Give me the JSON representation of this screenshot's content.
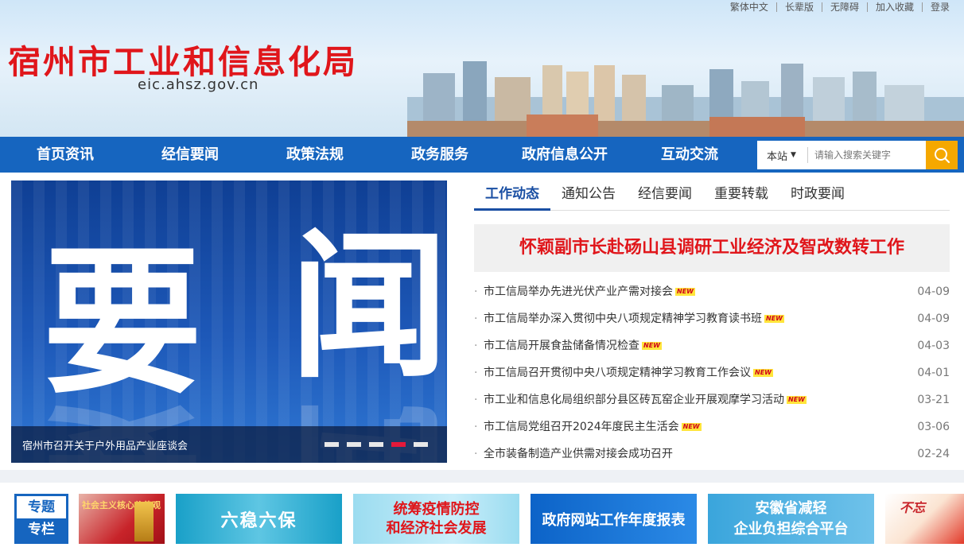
{
  "topbar": {
    "items": [
      "繁体中文",
      "长辈版",
      "无障碍",
      "加入收藏",
      "登录"
    ]
  },
  "header": {
    "title": "宿州市工业和信息化局",
    "domain": "eic.ahsz.gov.cn"
  },
  "nav": {
    "items": [
      "首页资讯",
      "经信要闻",
      "政策法规",
      "政务服务",
      "政府信息公开",
      "互动交流"
    ]
  },
  "search": {
    "scope": "本站",
    "placeholder": "请输入搜索关键字"
  },
  "carousel": {
    "big_text": [
      "要",
      "闻"
    ],
    "caption": "宿州市召开关于户外用品产业座谈会",
    "dot_count": 5,
    "active_dot": 4
  },
  "news": {
    "tabs": [
      "工作动态",
      "通知公告",
      "经信要闻",
      "重要转载",
      "时政要闻"
    ],
    "active_tab": 0,
    "headline": "怀颖副市长赴砀山县调研工业经济及智改数转工作",
    "new_badge": "NEW",
    "items": [
      {
        "title": "市工信局举办先进光伏产业产需对接会",
        "date": "04-09",
        "is_new": true
      },
      {
        "title": "市工信局举办深入贯彻中央八项规定精神学习教育读书班",
        "date": "04-09",
        "is_new": true
      },
      {
        "title": "市工信局开展食盐储备情况检查",
        "date": "04-03",
        "is_new": true
      },
      {
        "title": "市工信局召开贯彻中央八项规定精神学习教育工作会议",
        "date": "04-01",
        "is_new": true
      },
      {
        "title": "市工业和信息化局组织部分县区砖瓦窑企业开展观摩学习活动",
        "date": "03-21",
        "is_new": true
      },
      {
        "title": "市工信局党组召开2024年度民主生活会",
        "date": "03-06",
        "is_new": true
      },
      {
        "title": "全市装备制造产业供需对接会成功召开",
        "date": "02-24",
        "is_new": false
      }
    ]
  },
  "special": {
    "label_top": "专题",
    "label_bottom": "专栏",
    "banners": [
      {
        "line1": "社会主义核心价值观",
        "line2": ""
      },
      {
        "line1": "六稳六保",
        "line2": ""
      },
      {
        "line1": "统筹疫情防控",
        "line2": "和经济社会发展"
      },
      {
        "line1": "政府网站工作年度报表",
        "line2": ""
      },
      {
        "line1": "安徽省减轻",
        "line2": "企业负担综合平台"
      },
      {
        "line1": "不忘",
        "line2": ""
      }
    ]
  },
  "colors": {
    "brand_blue": "#1665bf",
    "title_red": "#e0161b",
    "search_orange": "#f5a800",
    "active_dot": "#e5193a"
  }
}
